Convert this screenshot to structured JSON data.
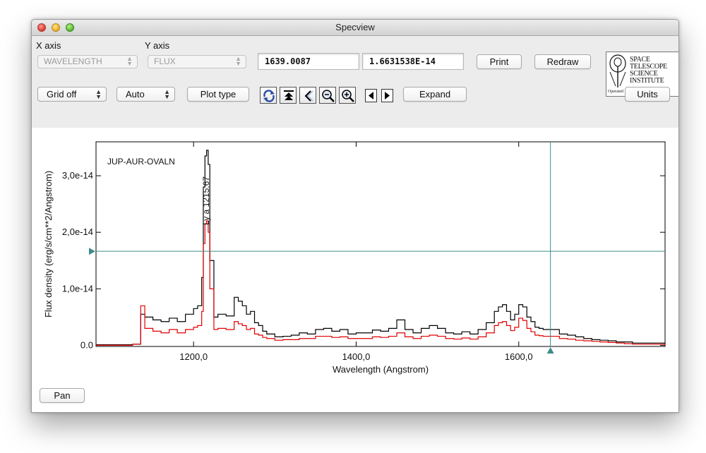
{
  "window": {
    "title": "Specview"
  },
  "controls": {
    "x_axis_label": "X axis",
    "y_axis_label": "Y axis",
    "x_axis_value": "WAVELENGTH",
    "y_axis_value": "FLUX",
    "x_cursor_value": "1639.0087",
    "y_cursor_value": "1.6631538E-14",
    "print_label": "Print",
    "redraw_label": "Redraw",
    "grid_label": "Grid off",
    "scale_label": "Auto",
    "plot_type_label": "Plot type",
    "expand_label": "Expand",
    "units_label": "Units",
    "pan_label": "Pan"
  },
  "logo": {
    "line1": "SPACE",
    "line2": "TELESCOPE",
    "line3": "SCIENCE",
    "line4": "INSTITUTE",
    "subtitle": "Operated for NASA by AURA"
  },
  "icons": [
    "reload-icon",
    "top-icon",
    "back-icon",
    "zoom-out-icon",
    "zoom-in-icon",
    "left-arrow-icon",
    "right-arrow-icon"
  ],
  "colors": {
    "accent": "#3d8c8a",
    "series_black": "#000000",
    "series_red": "#e00000"
  },
  "chart_data": {
    "type": "line",
    "title": "",
    "annotation_target": "JUP-AUR-OVALN",
    "line_id": "Ly a 1215.67",
    "xlabel": "Wavelength (Angstrom)",
    "ylabel": "Flux density (erg/s/cm**2/Angstrom)",
    "xlim": [
      1080,
      1780
    ],
    "ylim": [
      -2e-16,
      3.6e-14
    ],
    "x_ticks": [
      1200,
      1400,
      1600
    ],
    "x_tick_labels": [
      "1200,0",
      "1400,0",
      "1600,0"
    ],
    "y_ticks": [
      0,
      1e-14,
      2e-14,
      3e-14
    ],
    "y_tick_labels": [
      "0.0",
      "1,0e-14",
      "2,0e-14",
      "3,0e-14"
    ],
    "cursor": {
      "x": 1639.0087,
      "y": 1.6631538e-14
    },
    "grid": false,
    "series": [
      {
        "x": [
          1080,
          1125,
          1135,
          1140,
          1150,
          1160,
          1170,
          1180,
          1190,
          1200,
          1205,
          1210,
          1212,
          1214,
          1216,
          1218,
          1220,
          1225,
          1230,
          1240,
          1250,
          1255,
          1260,
          1265,
          1270,
          1275,
          1280,
          1285,
          1290,
          1300,
          1310,
          1320,
          1330,
          1340,
          1350,
          1360,
          1370,
          1380,
          1390,
          1400,
          1410,
          1420,
          1430,
          1440,
          1450,
          1460,
          1470,
          1480,
          1490,
          1500,
          1510,
          1520,
          1530,
          1540,
          1550,
          1560,
          1570,
          1575,
          1580,
          1585,
          1590,
          1595,
          1600,
          1605,
          1610,
          1615,
          1620,
          1625,
          1630,
          1640,
          1650,
          1660,
          1670,
          1680,
          1690,
          1700,
          1710,
          1720,
          1730,
          1740,
          1780
        ],
        "y": [
          0.01,
          0.02,
          0.55,
          0.5,
          0.45,
          0.42,
          0.48,
          0.42,
          0.55,
          0.65,
          0.7,
          1.2,
          2.8,
          3.35,
          3.45,
          3.2,
          1.5,
          0.5,
          0.55,
          0.52,
          0.85,
          0.78,
          0.7,
          0.55,
          0.6,
          0.4,
          0.35,
          0.25,
          0.2,
          0.15,
          0.16,
          0.18,
          0.22,
          0.2,
          0.28,
          0.3,
          0.25,
          0.28,
          0.2,
          0.22,
          0.22,
          0.27,
          0.25,
          0.3,
          0.45,
          0.28,
          0.22,
          0.3,
          0.35,
          0.3,
          0.22,
          0.2,
          0.24,
          0.2,
          0.28,
          0.4,
          0.6,
          0.68,
          0.72,
          0.6,
          0.45,
          0.55,
          0.72,
          0.68,
          0.5,
          0.42,
          0.32,
          0.3,
          0.28,
          0.28,
          0.2,
          0.18,
          0.15,
          0.12,
          0.1,
          0.09,
          0.08,
          0.06,
          0.06,
          0.04,
          0.01
        ]
      },
      {
        "x": [
          1080,
          1125,
          1135,
          1140,
          1150,
          1160,
          1170,
          1180,
          1190,
          1200,
          1205,
          1210,
          1212,
          1214,
          1216,
          1218,
          1220,
          1225,
          1230,
          1240,
          1250,
          1255,
          1260,
          1265,
          1270,
          1275,
          1280,
          1285,
          1290,
          1300,
          1310,
          1320,
          1330,
          1340,
          1350,
          1360,
          1370,
          1380,
          1390,
          1400,
          1410,
          1420,
          1430,
          1440,
          1450,
          1460,
          1470,
          1480,
          1490,
          1500,
          1510,
          1520,
          1530,
          1540,
          1550,
          1560,
          1570,
          1575,
          1580,
          1585,
          1590,
          1595,
          1600,
          1605,
          1610,
          1615,
          1620,
          1625,
          1630,
          1640,
          1650,
          1660,
          1670,
          1680,
          1690,
          1700,
          1710,
          1720,
          1730,
          1740,
          1780
        ],
        "y": [
          0.0,
          0.02,
          0.7,
          0.3,
          0.25,
          0.22,
          0.28,
          0.22,
          0.28,
          0.32,
          0.35,
          0.6,
          1.8,
          2.15,
          2.2,
          2.0,
          1.0,
          0.28,
          0.3,
          0.28,
          0.42,
          0.38,
          0.35,
          0.28,
          0.3,
          0.2,
          0.18,
          0.14,
          0.12,
          0.09,
          0.1,
          0.1,
          0.12,
          0.12,
          0.16,
          0.16,
          0.14,
          0.15,
          0.12,
          0.12,
          0.12,
          0.15,
          0.14,
          0.16,
          0.22,
          0.15,
          0.12,
          0.16,
          0.18,
          0.16,
          0.12,
          0.11,
          0.13,
          0.11,
          0.15,
          0.22,
          0.35,
          0.4,
          0.42,
          0.35,
          0.26,
          0.32,
          0.48,
          0.44,
          0.3,
          0.24,
          0.18,
          0.17,
          0.16,
          0.16,
          0.12,
          0.11,
          0.09,
          0.08,
          0.07,
          0.06,
          0.05,
          0.04,
          0.03,
          0.02,
          0.0
        ]
      }
    ]
  }
}
